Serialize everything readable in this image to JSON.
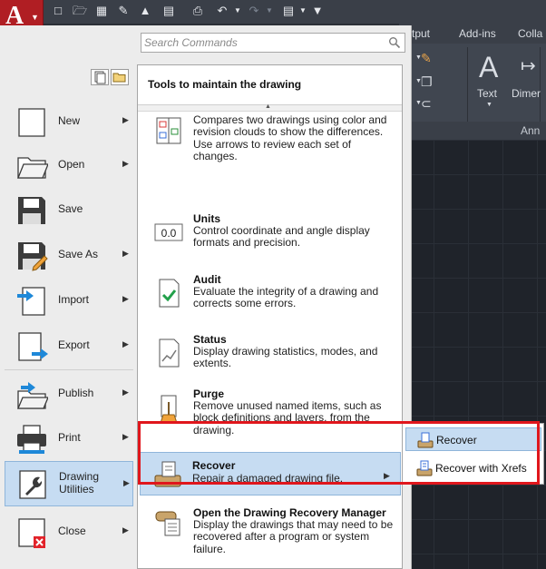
{
  "app": {
    "logo_letter": "A"
  },
  "ribbon": {
    "tabs": [
      "tput",
      "Add-ins",
      "Colla"
    ],
    "text_tool_label": "Text",
    "dimension_label": "Dimer",
    "panel_footer_label": "Ann"
  },
  "search": {
    "placeholder": "Search Commands"
  },
  "left_menu": [
    {
      "label": "New",
      "icon": "new-document-icon",
      "has_arrow": true
    },
    {
      "label": "Open",
      "icon": "open-folder-icon",
      "has_arrow": true
    },
    {
      "label": "Save",
      "icon": "save-floppy-icon",
      "has_arrow": false
    },
    {
      "label": "Save As",
      "icon": "save-as-icon",
      "has_arrow": true
    },
    {
      "label": "Import",
      "icon": "import-icon",
      "has_arrow": true
    },
    {
      "label": "Export",
      "icon": "export-icon",
      "has_arrow": true
    },
    {
      "label": "Publish",
      "icon": "publish-icon",
      "has_arrow": true
    },
    {
      "label": "Print",
      "icon": "printer-icon",
      "has_arrow": true
    },
    {
      "label": "Drawing\nUtilities",
      "icon": "wrench-icon",
      "has_arrow": true,
      "active": true
    },
    {
      "label": "Close",
      "icon": "close-document-icon",
      "has_arrow": true
    }
  ],
  "submenu": {
    "title": "Tools to maintain the drawing",
    "items": [
      {
        "title": "",
        "description": "Compares two drawings using color and revision clouds to show the differences. Use arrows to review each set of changes.",
        "icon": "drawing-compare-icon"
      },
      {
        "title": "Units",
        "description": "Control coordinate and angle display formats and precision.",
        "icon": "units-icon"
      },
      {
        "title": "Audit",
        "description": "Evaluate the integrity of a drawing and corrects some errors.",
        "icon": "audit-check-icon"
      },
      {
        "title": "Status",
        "description": "Display drawing statistics, modes, and extents.",
        "icon": "status-chart-icon"
      },
      {
        "title": "Purge",
        "description": "Remove unused named items, such as block definitions and layers, from the drawing.",
        "icon": "purge-broom-icon"
      },
      {
        "title": "Recover",
        "description": "Repair a damaged drawing file.",
        "icon": "recover-icon",
        "active": true
      },
      {
        "title": "Open the Drawing Recovery Manager",
        "description": "Display the drawings that may need to be recovered after a program or system failure.",
        "icon": "recovery-manager-icon"
      }
    ]
  },
  "flyout": {
    "items": [
      {
        "label": "Recover",
        "active": true
      },
      {
        "label": "Recover with Xrefs",
        "active": false
      }
    ]
  },
  "colors": {
    "brand_red": "#b01e23",
    "highlight_blue": "#c6dcf2",
    "annotation_red": "#e0161c"
  }
}
